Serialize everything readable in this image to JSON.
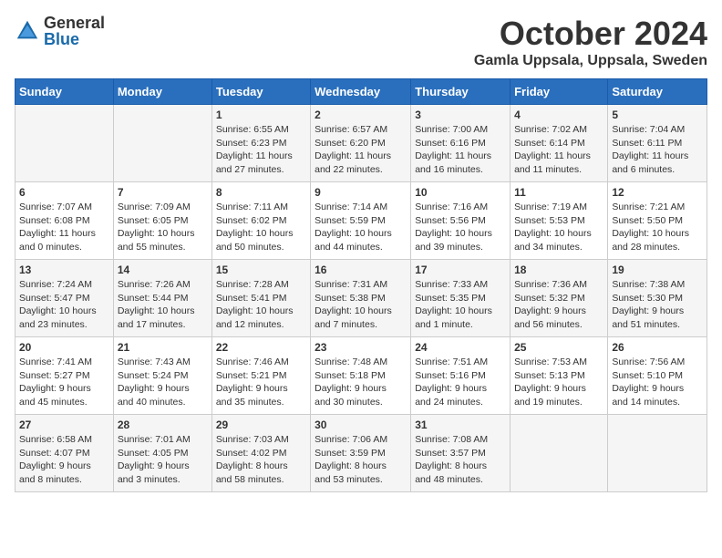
{
  "header": {
    "logo_general": "General",
    "logo_blue": "Blue",
    "month_title": "October 2024",
    "location": "Gamla Uppsala, Uppsala, Sweden"
  },
  "weekdays": [
    "Sunday",
    "Monday",
    "Tuesday",
    "Wednesday",
    "Thursday",
    "Friday",
    "Saturday"
  ],
  "weeks": [
    [
      {
        "day": "",
        "info": ""
      },
      {
        "day": "",
        "info": ""
      },
      {
        "day": "1",
        "info": "Sunrise: 6:55 AM\nSunset: 6:23 PM\nDaylight: 11 hours\nand 27 minutes."
      },
      {
        "day": "2",
        "info": "Sunrise: 6:57 AM\nSunset: 6:20 PM\nDaylight: 11 hours\nand 22 minutes."
      },
      {
        "day": "3",
        "info": "Sunrise: 7:00 AM\nSunset: 6:16 PM\nDaylight: 11 hours\nand 16 minutes."
      },
      {
        "day": "4",
        "info": "Sunrise: 7:02 AM\nSunset: 6:14 PM\nDaylight: 11 hours\nand 11 minutes."
      },
      {
        "day": "5",
        "info": "Sunrise: 7:04 AM\nSunset: 6:11 PM\nDaylight: 11 hours\nand 6 minutes."
      }
    ],
    [
      {
        "day": "6",
        "info": "Sunrise: 7:07 AM\nSunset: 6:08 PM\nDaylight: 11 hours\nand 0 minutes."
      },
      {
        "day": "7",
        "info": "Sunrise: 7:09 AM\nSunset: 6:05 PM\nDaylight: 10 hours\nand 55 minutes."
      },
      {
        "day": "8",
        "info": "Sunrise: 7:11 AM\nSunset: 6:02 PM\nDaylight: 10 hours\nand 50 minutes."
      },
      {
        "day": "9",
        "info": "Sunrise: 7:14 AM\nSunset: 5:59 PM\nDaylight: 10 hours\nand 44 minutes."
      },
      {
        "day": "10",
        "info": "Sunrise: 7:16 AM\nSunset: 5:56 PM\nDaylight: 10 hours\nand 39 minutes."
      },
      {
        "day": "11",
        "info": "Sunrise: 7:19 AM\nSunset: 5:53 PM\nDaylight: 10 hours\nand 34 minutes."
      },
      {
        "day": "12",
        "info": "Sunrise: 7:21 AM\nSunset: 5:50 PM\nDaylight: 10 hours\nand 28 minutes."
      }
    ],
    [
      {
        "day": "13",
        "info": "Sunrise: 7:24 AM\nSunset: 5:47 PM\nDaylight: 10 hours\nand 23 minutes."
      },
      {
        "day": "14",
        "info": "Sunrise: 7:26 AM\nSunset: 5:44 PM\nDaylight: 10 hours\nand 17 minutes."
      },
      {
        "day": "15",
        "info": "Sunrise: 7:28 AM\nSunset: 5:41 PM\nDaylight: 10 hours\nand 12 minutes."
      },
      {
        "day": "16",
        "info": "Sunrise: 7:31 AM\nSunset: 5:38 PM\nDaylight: 10 hours\nand 7 minutes."
      },
      {
        "day": "17",
        "info": "Sunrise: 7:33 AM\nSunset: 5:35 PM\nDaylight: 10 hours\nand 1 minute."
      },
      {
        "day": "18",
        "info": "Sunrise: 7:36 AM\nSunset: 5:32 PM\nDaylight: 9 hours\nand 56 minutes."
      },
      {
        "day": "19",
        "info": "Sunrise: 7:38 AM\nSunset: 5:30 PM\nDaylight: 9 hours\nand 51 minutes."
      }
    ],
    [
      {
        "day": "20",
        "info": "Sunrise: 7:41 AM\nSunset: 5:27 PM\nDaylight: 9 hours\nand 45 minutes."
      },
      {
        "day": "21",
        "info": "Sunrise: 7:43 AM\nSunset: 5:24 PM\nDaylight: 9 hours\nand 40 minutes."
      },
      {
        "day": "22",
        "info": "Sunrise: 7:46 AM\nSunset: 5:21 PM\nDaylight: 9 hours\nand 35 minutes."
      },
      {
        "day": "23",
        "info": "Sunrise: 7:48 AM\nSunset: 5:18 PM\nDaylight: 9 hours\nand 30 minutes."
      },
      {
        "day": "24",
        "info": "Sunrise: 7:51 AM\nSunset: 5:16 PM\nDaylight: 9 hours\nand 24 minutes."
      },
      {
        "day": "25",
        "info": "Sunrise: 7:53 AM\nSunset: 5:13 PM\nDaylight: 9 hours\nand 19 minutes."
      },
      {
        "day": "26",
        "info": "Sunrise: 7:56 AM\nSunset: 5:10 PM\nDaylight: 9 hours\nand 14 minutes."
      }
    ],
    [
      {
        "day": "27",
        "info": "Sunrise: 6:58 AM\nSunset: 4:07 PM\nDaylight: 9 hours\nand 8 minutes."
      },
      {
        "day": "28",
        "info": "Sunrise: 7:01 AM\nSunset: 4:05 PM\nDaylight: 9 hours\nand 3 minutes."
      },
      {
        "day": "29",
        "info": "Sunrise: 7:03 AM\nSunset: 4:02 PM\nDaylight: 8 hours\nand 58 minutes."
      },
      {
        "day": "30",
        "info": "Sunrise: 7:06 AM\nSunset: 3:59 PM\nDaylight: 8 hours\nand 53 minutes."
      },
      {
        "day": "31",
        "info": "Sunrise: 7:08 AM\nSunset: 3:57 PM\nDaylight: 8 hours\nand 48 minutes."
      },
      {
        "day": "",
        "info": ""
      },
      {
        "day": "",
        "info": ""
      }
    ]
  ]
}
